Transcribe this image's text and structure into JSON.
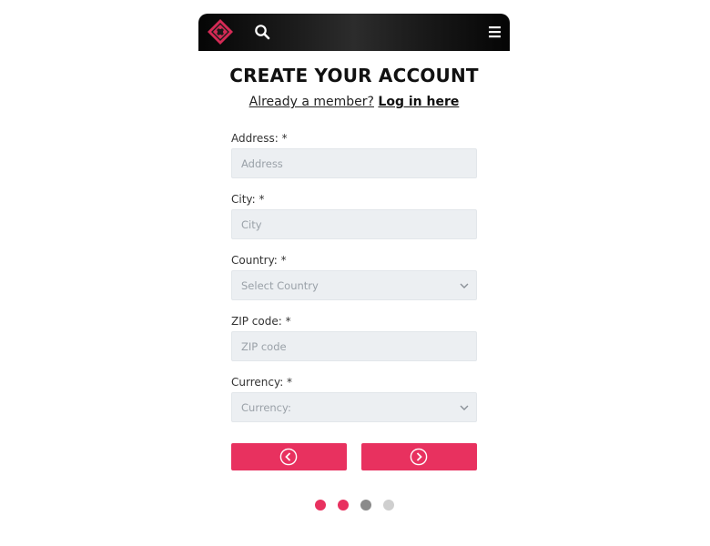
{
  "header": {
    "logo_icon": "red-diamond-logo-icon",
    "search_icon": "search-icon",
    "menu_icon": "hamburger-menu-icon"
  },
  "page": {
    "title": "CREATE YOUR ACCOUNT",
    "member_text": "Already a member?",
    "login_link": "Log in here"
  },
  "form": {
    "address": {
      "label": "Address: *",
      "placeholder": "Address"
    },
    "city": {
      "label": "City: *",
      "placeholder": "City"
    },
    "country": {
      "label": "Country: *",
      "placeholder": "Select Country"
    },
    "zip": {
      "label": "ZIP code: *",
      "placeholder": "ZIP code"
    },
    "currency": {
      "label": "Currency: *",
      "placeholder": "Currency:"
    }
  },
  "navigation": {
    "prev_icon": "chevron-left-circle-icon",
    "next_icon": "chevron-right-circle-icon"
  },
  "steps": {
    "total": 4,
    "completed": 2,
    "current": 3
  },
  "colors": {
    "accent": "#e8315f",
    "header_bg": "#111111",
    "field_bg": "#eceff2",
    "dot_completed": "#e8315f",
    "dot_current": "#8a8a8a",
    "dot_upcoming": "#cfcfcf"
  }
}
